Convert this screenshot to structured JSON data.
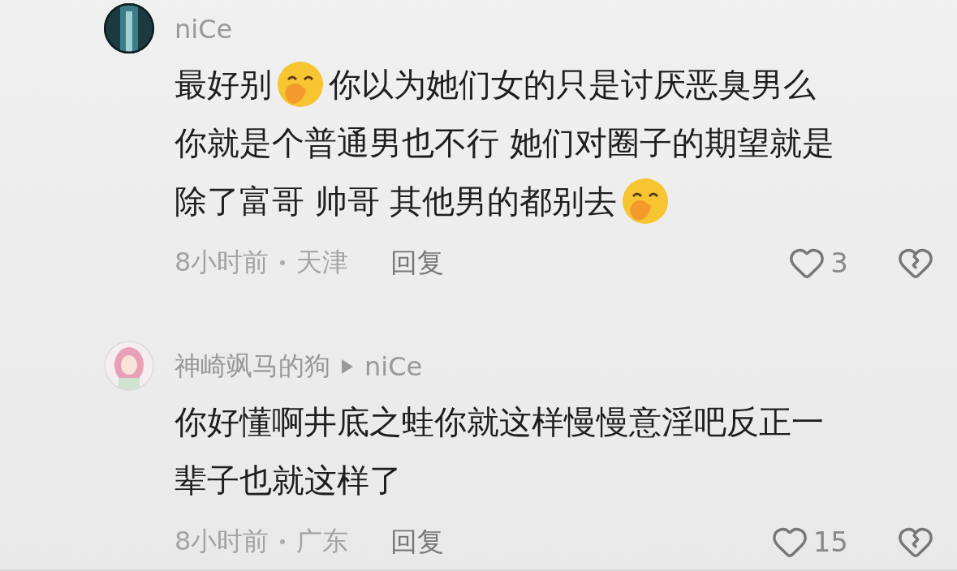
{
  "comments": [
    {
      "author": "niCe",
      "avatar": {
        "kind": "picture"
      },
      "lines": [
        [
          {
            "kind": "text",
            "text": "最好别"
          },
          {
            "kind": "emoji"
          },
          {
            "kind": "text",
            "text": "你以为她们女的只是讨厌恶臭男么"
          }
        ],
        [
          {
            "kind": "text",
            "text": "你就是个普通男也不行 她们对圈子的期望就是"
          }
        ],
        [
          {
            "kind": "text",
            "text": "除了富哥 帅哥 其他男的都别去"
          },
          {
            "kind": "emoji"
          }
        ]
      ],
      "time": "8小时前",
      "location": "天津",
      "reply": "回复",
      "likes": "3"
    },
    {
      "author": "神崎飒马的狗",
      "reply_to": "niCe",
      "avatar": {
        "kind": "picture"
      },
      "lines": [
        [
          {
            "kind": "text",
            "text": "你好懂啊井底之蛙你就这样慢慢意淫吧反正一"
          }
        ],
        [
          {
            "kind": "text",
            "text": "辈子也就这样了"
          }
        ]
      ],
      "time": "8小时前",
      "location": "广东",
      "reply": "回复",
      "likes": "15"
    }
  ]
}
